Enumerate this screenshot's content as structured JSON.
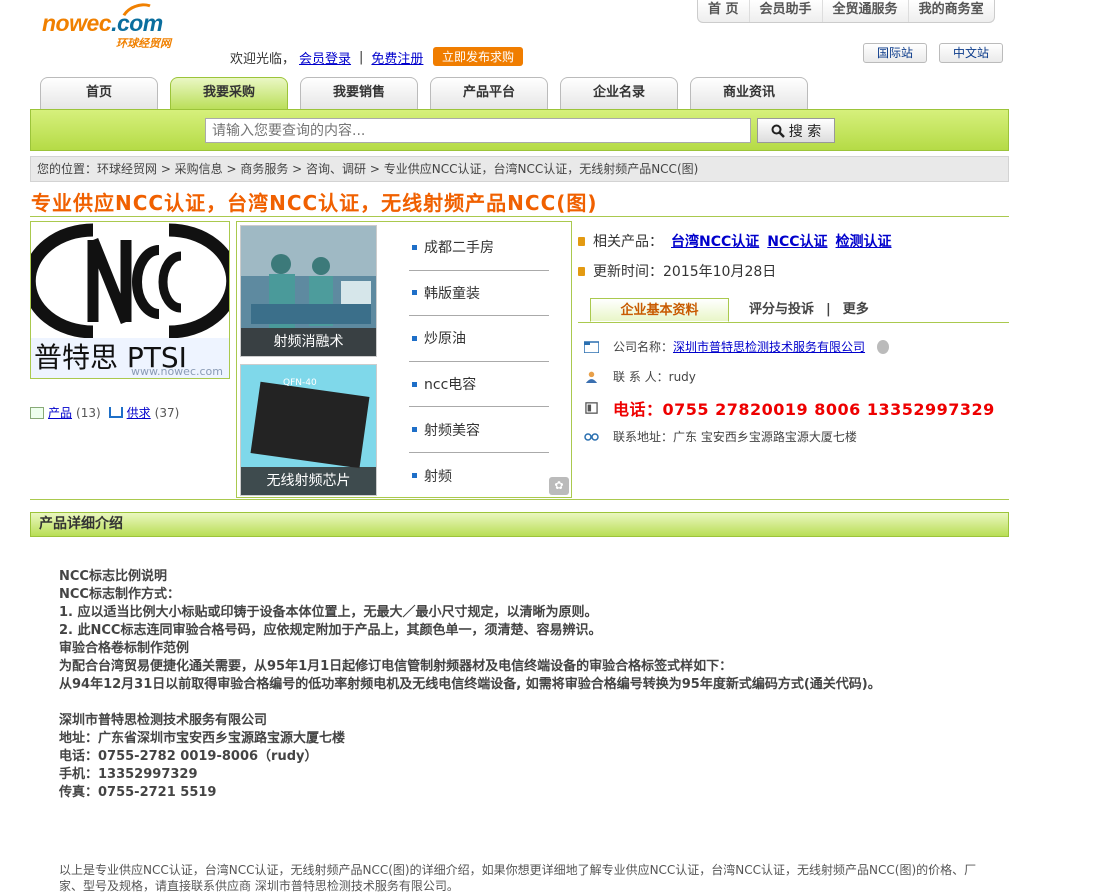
{
  "logo": {
    "brand_main": "nowec",
    "brand_dot": ".com",
    "subtitle": "环球经贸网"
  },
  "topnav": [
    "首 页",
    "会员助手",
    "全贸通服务",
    "我的商务室"
  ],
  "welcome": {
    "text": "欢迎光临，",
    "login": "会员登录",
    "sep": "|",
    "register": "免费注册",
    "publish": "立即发布求购"
  },
  "sites": {
    "intl": "国际站",
    "cn": "中文站"
  },
  "tabs": [
    "首页",
    "我要采购",
    "我要销售",
    "产品平台",
    "企业名录",
    "商业资讯"
  ],
  "search": {
    "placeholder": "请输入您要查询的内容...",
    "button": "搜 索"
  },
  "breadcrumb": "您的位置：环球经贸网 > 采购信息 > 商务服务 > 咨询、调研 > 专业供应NCC认证，台湾NCC认证，无线射频产品NCC(图)",
  "page_title": "专业供应NCC认证，台湾NCC认证，无线射频产品NCC(图)",
  "product_image": {
    "logo_text": "普特思  PTSI",
    "watermark": "www.nowec.com"
  },
  "stats": {
    "products_label": "产品",
    "products_count": "(13)",
    "purchase_label": "供求",
    "purchase_count": "(37)"
  },
  "recommend": {
    "thumb1_caption": "射频消融术",
    "thumb2_caption": "无线射频芯片",
    "chip_label": "QFN-40",
    "list": [
      "成都二手房",
      "韩版童装",
      "炒原油",
      "ncc电容",
      "射频美容",
      "射频"
    ]
  },
  "info": {
    "related_label": "相关产品：",
    "related": [
      "台湾NCC认证",
      "NCC认证",
      "检测认证"
    ],
    "updated_label": "更新时间：",
    "updated": "2015年10月28日"
  },
  "info_tabs": {
    "basic": "企业基本资料",
    "review": "评分与投诉",
    "sep": "|",
    "more": "更多"
  },
  "company": {
    "name_label": "公司名称：",
    "name": "深圳市普特思检测技术服务有限公司",
    "contact_label": "联 系 人：",
    "contact": "rudy",
    "phone": "电话：0755 27820019 8006  13352997329",
    "address_label": "联系地址：",
    "address": "广东 宝安西乡宝源路宝源大厦七楼"
  },
  "detail_heading": "产品详细介绍",
  "detail_lines": [
    "NCC标志比例说明",
    "NCC标志制作方式：",
    "1. 应以适当比例大小标贴或印铸于设备本体位置上，无最大／最小尺寸规定，以清晰为原则。",
    "2. 此NCC标志连同审验合格号码，应依规定附加于产品上，其颜色单一，须清楚、容易辨识。",
    "审验合格卷标制作范例",
    "为配合台湾贸易便捷化通关需要，从95年1月1日起修订电信管制射频器材及电信终端设备的审验合格标签式样如下：",
    "从94年12月31日以前取得审验合格编号的低功率射频电机及无线电信终端设备, 如需将审验合格编号转换为95年度新式编码方式(通关代码)。"
  ],
  "contact_block": [
    "深圳市普特思检测技术服务有限公司",
    "地址：广东省深圳市宝安西乡宝源路宝源大厦七楼",
    "电话：0755-2782 0019-8006（rudy）",
    "手机：13352997329",
    "传真：0755-2721 5519"
  ],
  "footer_note": "以上是专业供应NCC认证，台湾NCC认证，无线射频产品NCC(图)的详细介绍，如果你想更详细地了解专业供应NCC认证，台湾NCC认证，无线射频产品NCC(图)的价格、厂家、型号及规格，请直接联系供应商 深圳市普特思检测技术服务有限公司。"
}
